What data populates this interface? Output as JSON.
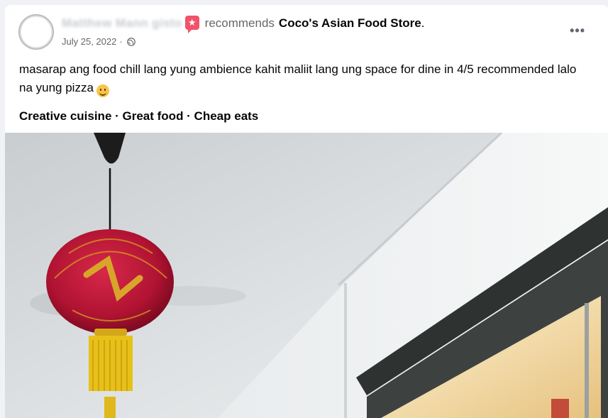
{
  "post": {
    "author": "Matthew Mann",
    "author_suffix": "gisto",
    "badge_icon": "recommend-flag-icon",
    "recommends_text": "recommends",
    "place": "Coco's Asian Food Store",
    "period": ".",
    "date": "July 25, 2022",
    "date_separator": "·",
    "privacy_icon": "globe-icon",
    "more_label": "•••",
    "review_text": "masarap ang food chill lang yung ambience kahit maliit lang ung space for dine in 4/5 recommended lalo na yung pizza",
    "emoji": "slightly-smiling-face-emoji",
    "tags": "Creative cuisine · Great food · Cheap eats"
  },
  "colors": {
    "badge": "#f25268",
    "secondary_text": "#65676b",
    "lantern_red": "#c0183a",
    "lantern_gold": "#e0b61a"
  }
}
